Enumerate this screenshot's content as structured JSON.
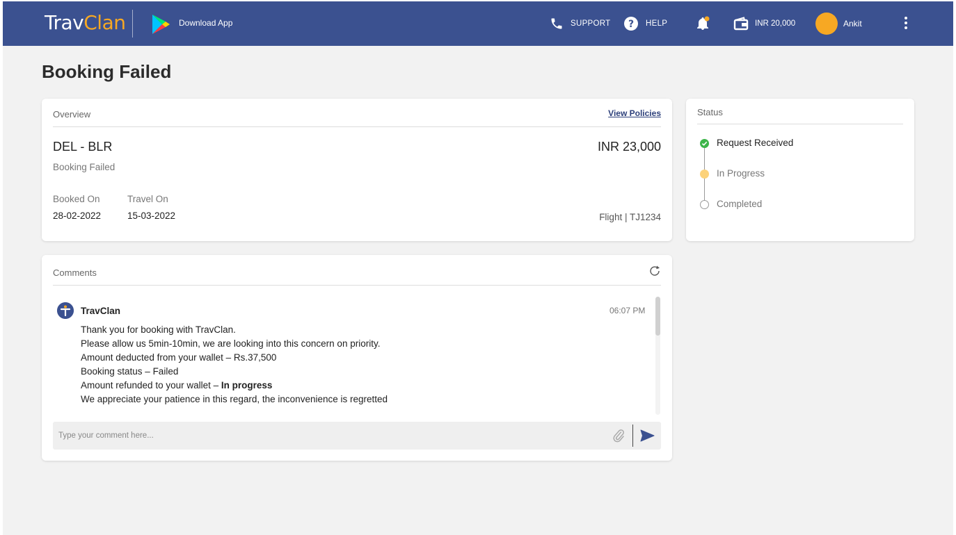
{
  "header": {
    "logo_trav": "Trav",
    "logo_clan": "Clan",
    "download_label": "Download App",
    "support_label": "SUPPORT",
    "help_label": "HELP",
    "wallet_balance": "INR 20,000",
    "user_name": "Ankit",
    "icons": {
      "play": "google-play-icon",
      "support": "phone-icon",
      "help": "help-circle-icon",
      "notifications": "bell-icon",
      "wallet": "wallet-icon",
      "menu": "more-vertical-icon"
    },
    "colors": {
      "bar": "#3b5190",
      "accent": "#f7a823"
    }
  },
  "page": {
    "title": "Booking Failed"
  },
  "overview": {
    "title": "Overview",
    "view_policies": "View Policies",
    "route": "DEL - BLR",
    "price": "INR 23,000",
    "status": "Booking Failed",
    "booked_on_label": "Booked On",
    "booked_on": "28-02-2022",
    "travel_on_label": "Travel On",
    "travel_on": "15-03-2022",
    "flight": "Flight | TJ1234"
  },
  "status": {
    "title": "Status",
    "steps": [
      {
        "label": "Request Received",
        "state": "done",
        "color": "#3db54a"
      },
      {
        "label": "In Progress",
        "state": "current",
        "color": "#fcd27a"
      },
      {
        "label": "Completed",
        "state": "pending",
        "color": "#ffffff"
      }
    ]
  },
  "comments": {
    "title": "Comments",
    "message": {
      "sender": "TravClan",
      "time": "06:07 PM",
      "lines": [
        "Thank you for booking with TravClan.",
        "Please allow us 5min-10min, we are looking into this concern on priority.",
        "Amount deducted from your wallet – Rs.37,500",
        "Booking status – Failed",
        "We appreciate your patience in this regard, the inconvenience is regretted"
      ],
      "refund_prefix": "Amount refunded to your wallet – ",
      "refund_status": "In progress"
    },
    "input_placeholder": "Type your comment here...",
    "input_value": ""
  }
}
